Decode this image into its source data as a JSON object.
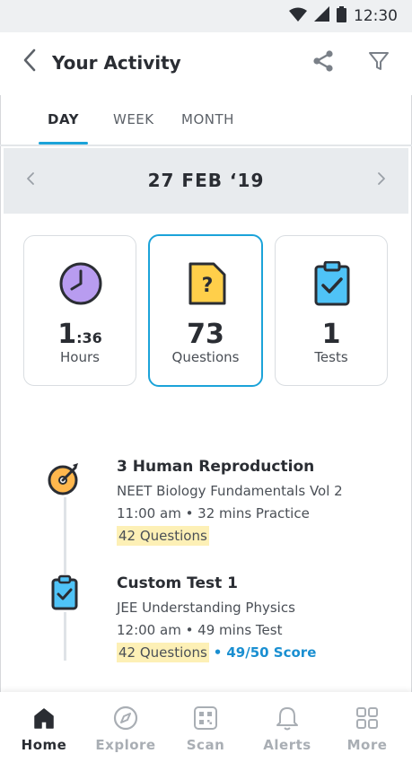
{
  "status_bar": {
    "time": "12:30",
    "icons": [
      "wifi-icon",
      "signal-icon",
      "battery-icon"
    ]
  },
  "header": {
    "title": "Your Activity",
    "back_icon": "chevron-left-icon",
    "share_icon": "share-icon",
    "filter_icon": "filter-icon"
  },
  "tabs": [
    {
      "label": "DAY",
      "active": true
    },
    {
      "label": "WEEK",
      "active": false
    },
    {
      "label": "MONTH",
      "active": false
    }
  ],
  "date_nav": {
    "label": "27 FEB ‘19",
    "prev_icon": "chevron-left-icon",
    "next_icon": "chevron-right-icon"
  },
  "stats": [
    {
      "icon": "clock-icon",
      "value": "1",
      "value_suffix": ":36",
      "label": "Hours",
      "selected": false
    },
    {
      "icon": "question-card-icon",
      "value": "73",
      "value_suffix": "",
      "label": "Questions",
      "selected": true
    },
    {
      "icon": "clipboard-check-icon",
      "value": "1",
      "value_suffix": "",
      "label": "Tests",
      "selected": false
    }
  ],
  "activities": [
    {
      "icon": "target-dart-icon",
      "title": "3 Human Reproduction",
      "subtitle": "NEET Biology Fundamentals Vol 2",
      "meta": "11:00 am • 32 mins Practice",
      "questions": "42 Questions",
      "score": ""
    },
    {
      "icon": "clipboard-check-icon",
      "title": "Custom Test 1",
      "subtitle": "JEE Understanding Physics",
      "meta": "12:00 am • 49 mins Test",
      "questions": "42 Questions",
      "separator": "•",
      "score": "49/50 Score"
    }
  ],
  "bottom_nav": [
    {
      "icon": "home-icon",
      "label": "Home",
      "active": true
    },
    {
      "icon": "compass-icon",
      "label": "Explore",
      "active": false
    },
    {
      "icon": "qr-scan-icon",
      "label": "Scan",
      "active": false
    },
    {
      "icon": "bell-icon",
      "label": "Alerts",
      "active": false
    },
    {
      "icon": "grid-icon",
      "label": "More",
      "active": false
    }
  ],
  "colors": {
    "accent": "#1ba3d9",
    "link": "#1a8fd1",
    "highlight": "#fdf0b6",
    "date_bar_bg": "#e8ebee",
    "clock_purple": "#b89cf0",
    "question_yellow": "#ffcf4a",
    "clipboard_blue": "#4fc3f7",
    "dart_orange": "#ffb74d"
  }
}
